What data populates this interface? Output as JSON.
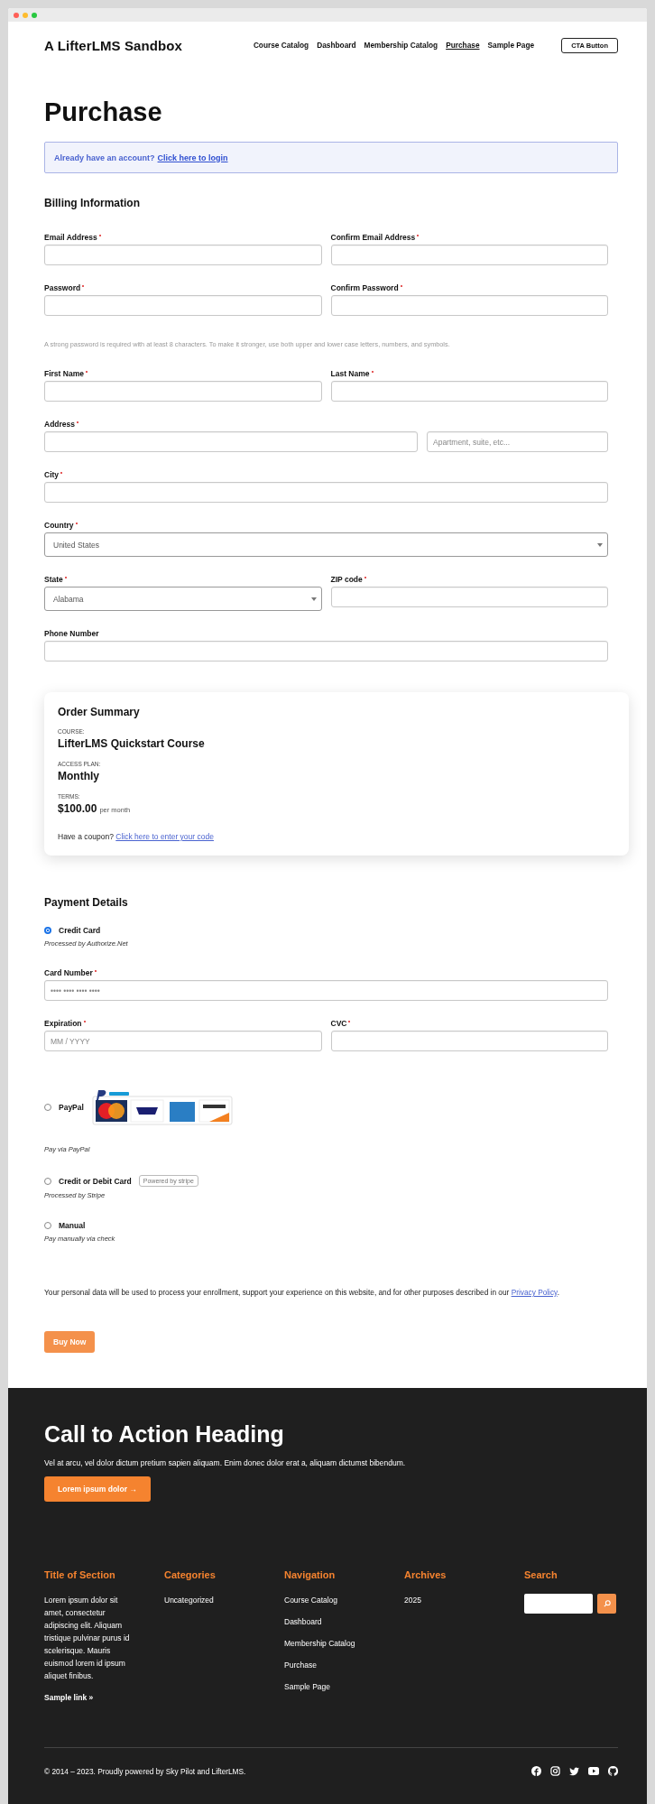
{
  "window": {
    "dots": [
      {
        "color": "#ff5f57"
      },
      {
        "color": "#febc2e"
      },
      {
        "color": "#28c840"
      }
    ]
  },
  "header": {
    "site_title": "A LifterLMS Sandbox",
    "nav": [
      {
        "label": "Course Catalog",
        "selected": false
      },
      {
        "label": "Dashboard",
        "selected": false
      },
      {
        "label": "Membership Catalog",
        "selected": false
      },
      {
        "label": "Purchase",
        "selected": true
      },
      {
        "label": "Sample Page",
        "selected": false
      }
    ],
    "cta_button": "CTA Button"
  },
  "page_title": "Purchase",
  "login_notice": {
    "text": "Already have an account?",
    "link": "Click here to login"
  },
  "billing": {
    "heading": "Billing Information",
    "rows": [
      {
        "kind": "pair",
        "fields": [
          {
            "label": "Email Address",
            "required": true,
            "kind": "text"
          },
          {
            "label": "Confirm Email Address",
            "required": true,
            "kind": "text"
          }
        ]
      },
      {
        "kind": "pair",
        "fields": [
          {
            "label": "Password",
            "required": true,
            "kind": "text"
          },
          {
            "label": "Confirm Password",
            "required": true,
            "kind": "text"
          }
        ]
      },
      {
        "kind": "hint",
        "text": "A strong password is required with at least 8 characters. To make it stronger, use both upper and lower case letters, numbers, and symbols."
      },
      {
        "kind": "pair",
        "fields": [
          {
            "label": "First Name",
            "required": true,
            "kind": "text"
          },
          {
            "label": "Last Name",
            "required": true,
            "kind": "text"
          }
        ]
      },
      {
        "kind": "address",
        "fields": [
          {
            "label": "Address",
            "required": true,
            "kind": "text"
          },
          {
            "kind": "text",
            "placeholder": "Apartment, suite, etc..."
          }
        ]
      },
      {
        "kind": "single",
        "fields": [
          {
            "label": "City",
            "required": true,
            "kind": "text"
          }
        ]
      },
      {
        "kind": "single",
        "fields": [
          {
            "label": "Country",
            "required": true,
            "kind": "select",
            "value": "United States"
          }
        ]
      },
      {
        "kind": "pair",
        "fields": [
          {
            "label": "State",
            "required": true,
            "kind": "select",
            "value": "Alabama"
          },
          {
            "label": "ZIP code",
            "required": true,
            "kind": "text"
          }
        ]
      },
      {
        "kind": "single",
        "fields": [
          {
            "label": "Phone Number",
            "required": false,
            "kind": "text"
          }
        ]
      }
    ]
  },
  "order_summary": {
    "heading": "Order Summary",
    "items": [
      {
        "label": "COURSE:",
        "value": "LifterLMS Quickstart Course"
      },
      {
        "label": "ACCESS PLAN:",
        "value": "Monthly"
      },
      {
        "label": "TERMS:",
        "value": "$100.00",
        "suffix": "per month"
      }
    ],
    "coupon": {
      "text": "Have a coupon?",
      "link": "Click here to enter your code"
    }
  },
  "payment": {
    "heading": "Payment Details",
    "methods": [
      {
        "kind": "card",
        "label": "Credit Card",
        "selected": true,
        "description": "Processed by Authorize.Net",
        "rows": [
          {
            "kind": "single",
            "fields": [
              {
                "label": "Card Number",
                "required": true,
                "kind": "text",
                "placeholder": "•••• •••• •••• ••••"
              }
            ]
          },
          {
            "kind": "pair",
            "fields": [
              {
                "label": "Expiration",
                "required": true,
                "kind": "text",
                "placeholder": "MM / YYYY"
              },
              {
                "label": "CVC",
                "required": true,
                "kind": "text"
              }
            ]
          }
        ]
      },
      {
        "kind": "paypal",
        "label": "PayPal",
        "selected": false,
        "description": "Pay via PayPal"
      },
      {
        "kind": "stripe",
        "label": "Credit or Debit Card",
        "selected": false,
        "badge": "Powered by stripe",
        "description": "Processed by Stripe"
      },
      {
        "kind": "manual",
        "label": "Manual",
        "selected": false,
        "description": "Pay manually via check"
      }
    ]
  },
  "privacy": {
    "text": "Your personal data will be used to process your enrollment, support your experience on this website, and for other purposes described in our",
    "link": "Privacy Policy",
    "end": "."
  },
  "buy_button": "Buy Now",
  "footer": {
    "cta": {
      "heading": "Call to Action Heading",
      "text": "Vel at arcu, vel dolor dictum pretium sapien aliquam. Enim donec dolor erat a, aliquam dictumst bibendum.",
      "button": "Lorem ipsum dolor →"
    },
    "columns": [
      {
        "kind": "text",
        "title": "Title of Section",
        "text": "Lorem ipsum dolor sit amet, consectetur adipiscing elit. Aliquam tristique pulvinar purus id scelerisque. Mauris euismod lorem id ipsum aliquet finibus.",
        "link": "Sample link »"
      },
      {
        "kind": "links",
        "title": "Categories",
        "links": [
          "Uncategorized"
        ]
      },
      {
        "kind": "links",
        "title": "Navigation",
        "links": [
          "Course Catalog",
          "Dashboard",
          "Membership Catalog",
          "Purchase",
          "Sample Page"
        ]
      },
      {
        "kind": "links",
        "title": "Archives",
        "links": [
          "2025"
        ]
      },
      {
        "kind": "search",
        "title": "Search"
      }
    ],
    "copyright": {
      "prefix": "© 2014 – 2023. Proudly powered by",
      "links": [
        "Sky Pilot",
        "LifterLMS"
      ],
      "joiner": "and",
      "end": "."
    },
    "social": [
      {
        "kind": "facebook"
      },
      {
        "kind": "instagram"
      },
      {
        "kind": "twitter"
      },
      {
        "kind": "youtube"
      },
      {
        "kind": "github"
      }
    ]
  }
}
